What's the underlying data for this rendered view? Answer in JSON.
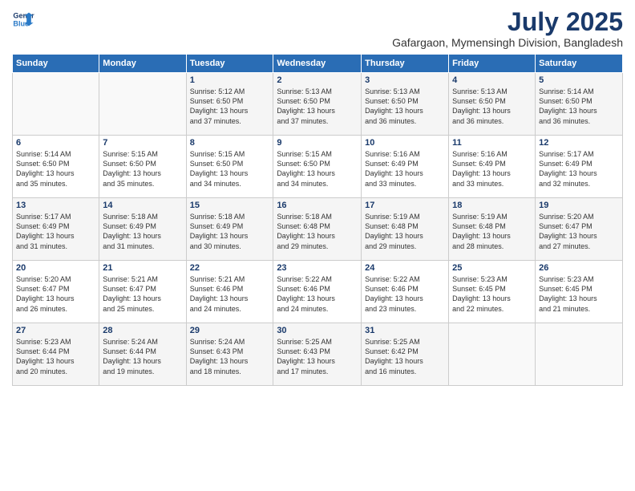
{
  "header": {
    "logo_line1": "General",
    "logo_line2": "Blue",
    "title": "July 2025",
    "subtitle": "Gafargaon, Mymensingh Division, Bangladesh"
  },
  "weekdays": [
    "Sunday",
    "Monday",
    "Tuesday",
    "Wednesday",
    "Thursday",
    "Friday",
    "Saturday"
  ],
  "weeks": [
    [
      {
        "day": "",
        "detail": ""
      },
      {
        "day": "",
        "detail": ""
      },
      {
        "day": "1",
        "detail": "Sunrise: 5:12 AM\nSunset: 6:50 PM\nDaylight: 13 hours\nand 37 minutes."
      },
      {
        "day": "2",
        "detail": "Sunrise: 5:13 AM\nSunset: 6:50 PM\nDaylight: 13 hours\nand 37 minutes."
      },
      {
        "day": "3",
        "detail": "Sunrise: 5:13 AM\nSunset: 6:50 PM\nDaylight: 13 hours\nand 36 minutes."
      },
      {
        "day": "4",
        "detail": "Sunrise: 5:13 AM\nSunset: 6:50 PM\nDaylight: 13 hours\nand 36 minutes."
      },
      {
        "day": "5",
        "detail": "Sunrise: 5:14 AM\nSunset: 6:50 PM\nDaylight: 13 hours\nand 36 minutes."
      }
    ],
    [
      {
        "day": "6",
        "detail": "Sunrise: 5:14 AM\nSunset: 6:50 PM\nDaylight: 13 hours\nand 35 minutes."
      },
      {
        "day": "7",
        "detail": "Sunrise: 5:15 AM\nSunset: 6:50 PM\nDaylight: 13 hours\nand 35 minutes."
      },
      {
        "day": "8",
        "detail": "Sunrise: 5:15 AM\nSunset: 6:50 PM\nDaylight: 13 hours\nand 34 minutes."
      },
      {
        "day": "9",
        "detail": "Sunrise: 5:15 AM\nSunset: 6:50 PM\nDaylight: 13 hours\nand 34 minutes."
      },
      {
        "day": "10",
        "detail": "Sunrise: 5:16 AM\nSunset: 6:49 PM\nDaylight: 13 hours\nand 33 minutes."
      },
      {
        "day": "11",
        "detail": "Sunrise: 5:16 AM\nSunset: 6:49 PM\nDaylight: 13 hours\nand 33 minutes."
      },
      {
        "day": "12",
        "detail": "Sunrise: 5:17 AM\nSunset: 6:49 PM\nDaylight: 13 hours\nand 32 minutes."
      }
    ],
    [
      {
        "day": "13",
        "detail": "Sunrise: 5:17 AM\nSunset: 6:49 PM\nDaylight: 13 hours\nand 31 minutes."
      },
      {
        "day": "14",
        "detail": "Sunrise: 5:18 AM\nSunset: 6:49 PM\nDaylight: 13 hours\nand 31 minutes."
      },
      {
        "day": "15",
        "detail": "Sunrise: 5:18 AM\nSunset: 6:49 PM\nDaylight: 13 hours\nand 30 minutes."
      },
      {
        "day": "16",
        "detail": "Sunrise: 5:18 AM\nSunset: 6:48 PM\nDaylight: 13 hours\nand 29 minutes."
      },
      {
        "day": "17",
        "detail": "Sunrise: 5:19 AM\nSunset: 6:48 PM\nDaylight: 13 hours\nand 29 minutes."
      },
      {
        "day": "18",
        "detail": "Sunrise: 5:19 AM\nSunset: 6:48 PM\nDaylight: 13 hours\nand 28 minutes."
      },
      {
        "day": "19",
        "detail": "Sunrise: 5:20 AM\nSunset: 6:47 PM\nDaylight: 13 hours\nand 27 minutes."
      }
    ],
    [
      {
        "day": "20",
        "detail": "Sunrise: 5:20 AM\nSunset: 6:47 PM\nDaylight: 13 hours\nand 26 minutes."
      },
      {
        "day": "21",
        "detail": "Sunrise: 5:21 AM\nSunset: 6:47 PM\nDaylight: 13 hours\nand 25 minutes."
      },
      {
        "day": "22",
        "detail": "Sunrise: 5:21 AM\nSunset: 6:46 PM\nDaylight: 13 hours\nand 24 minutes."
      },
      {
        "day": "23",
        "detail": "Sunrise: 5:22 AM\nSunset: 6:46 PM\nDaylight: 13 hours\nand 24 minutes."
      },
      {
        "day": "24",
        "detail": "Sunrise: 5:22 AM\nSunset: 6:46 PM\nDaylight: 13 hours\nand 23 minutes."
      },
      {
        "day": "25",
        "detail": "Sunrise: 5:23 AM\nSunset: 6:45 PM\nDaylight: 13 hours\nand 22 minutes."
      },
      {
        "day": "26",
        "detail": "Sunrise: 5:23 AM\nSunset: 6:45 PM\nDaylight: 13 hours\nand 21 minutes."
      }
    ],
    [
      {
        "day": "27",
        "detail": "Sunrise: 5:23 AM\nSunset: 6:44 PM\nDaylight: 13 hours\nand 20 minutes."
      },
      {
        "day": "28",
        "detail": "Sunrise: 5:24 AM\nSunset: 6:44 PM\nDaylight: 13 hours\nand 19 minutes."
      },
      {
        "day": "29",
        "detail": "Sunrise: 5:24 AM\nSunset: 6:43 PM\nDaylight: 13 hours\nand 18 minutes."
      },
      {
        "day": "30",
        "detail": "Sunrise: 5:25 AM\nSunset: 6:43 PM\nDaylight: 13 hours\nand 17 minutes."
      },
      {
        "day": "31",
        "detail": "Sunrise: 5:25 AM\nSunset: 6:42 PM\nDaylight: 13 hours\nand 16 minutes."
      },
      {
        "day": "",
        "detail": ""
      },
      {
        "day": "",
        "detail": ""
      }
    ]
  ]
}
